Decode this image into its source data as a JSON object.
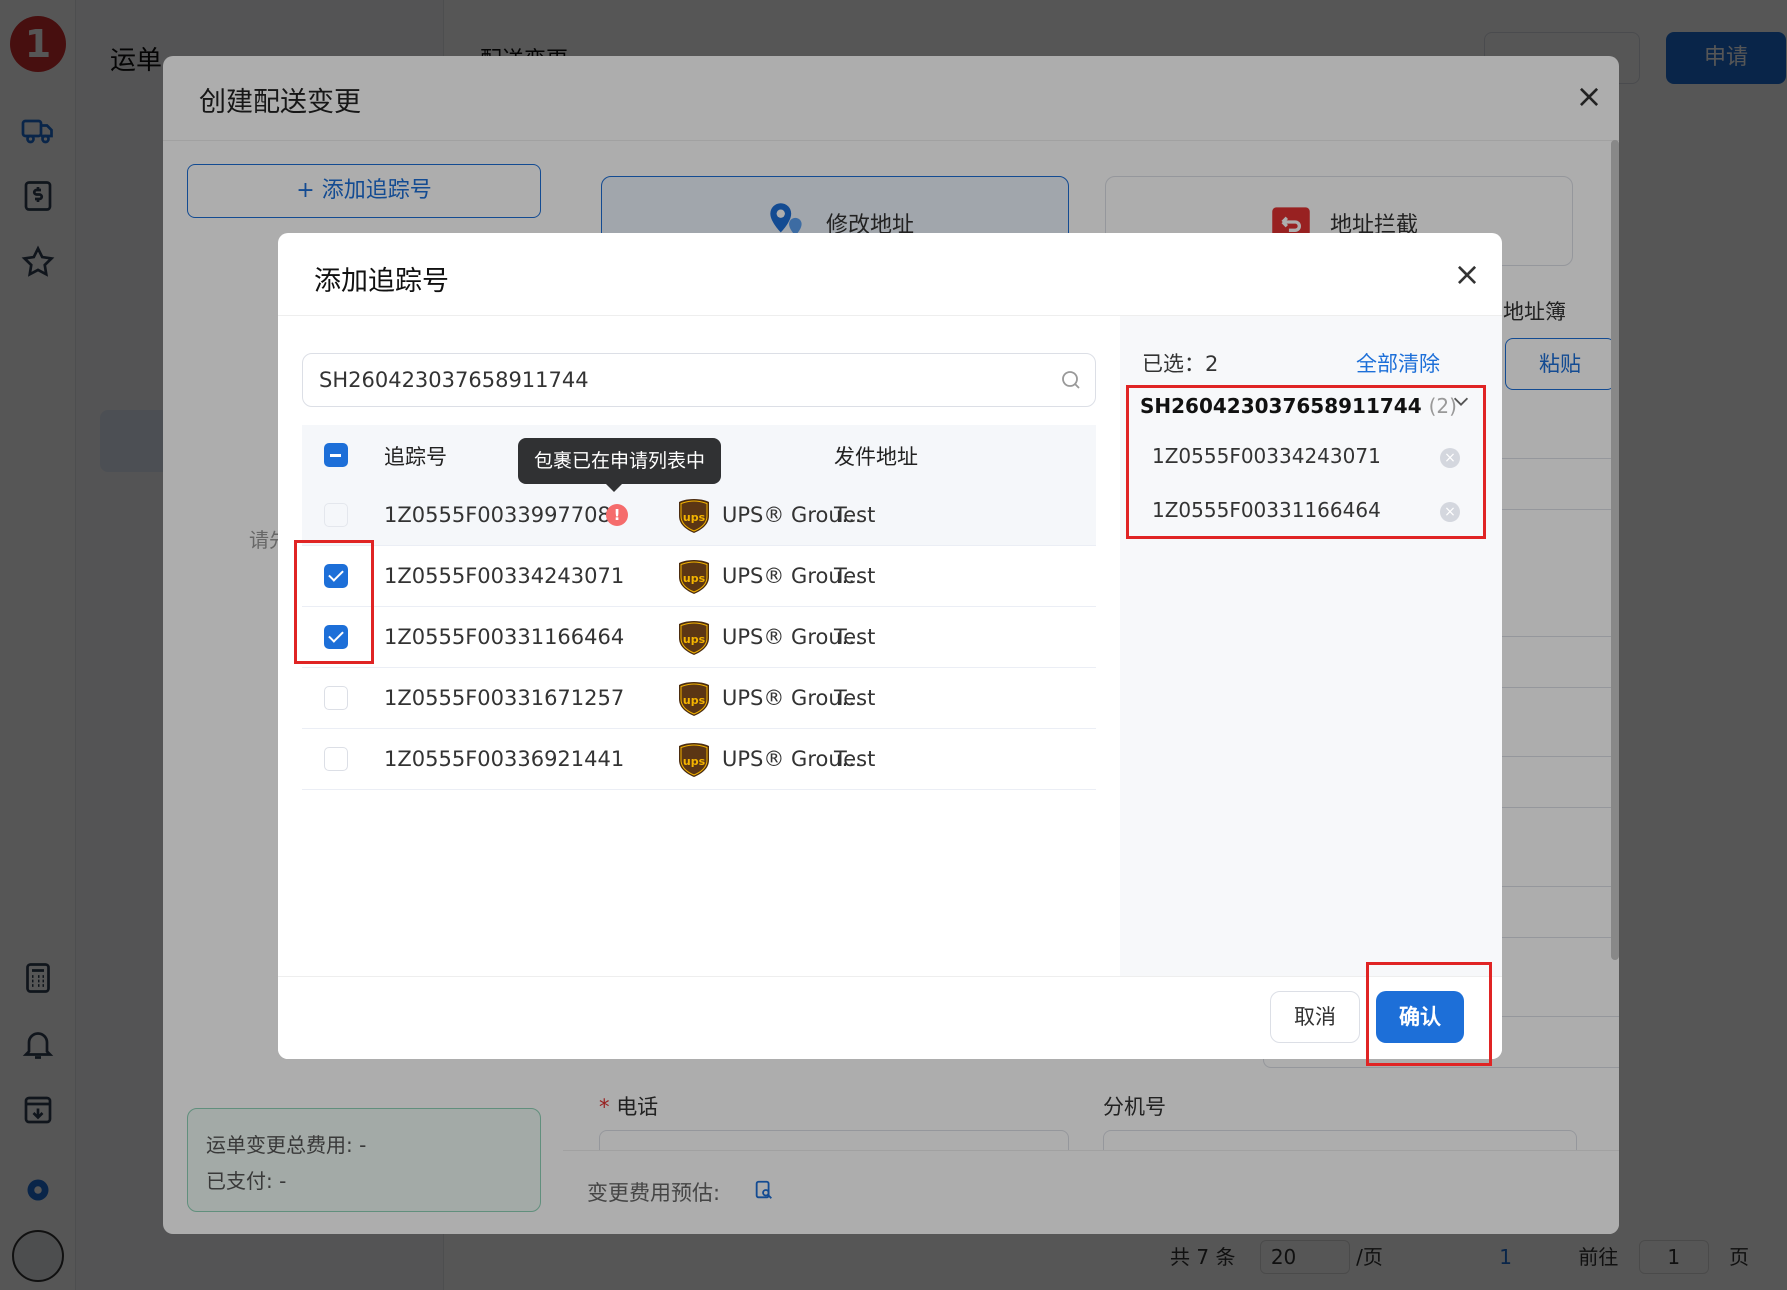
{
  "app": {
    "logo_text": "1",
    "nav_title": "运单",
    "base_header": "配送变更",
    "apply_button": "申请",
    "left_hint": "请先",
    "pager": {
      "total": "共 7 条",
      "page_size": "20",
      "per_page": "/页",
      "current": "1",
      "goto": "前往",
      "goto_value": "1",
      "page_unit": "页"
    }
  },
  "create_dialog": {
    "title": "创建配送变更",
    "add_tracking_button": "+ 添加追踪号",
    "options": [
      {
        "label": "修改地址",
        "icon": "location-pin-icon",
        "active": true
      },
      {
        "label": "地址拦截",
        "icon": "return-box-icon",
        "active": false
      }
    ],
    "address_book": "地址簿",
    "paste_button": "粘贴",
    "phone_label": "电话",
    "ext_label": "分机号",
    "fee_total_label": "运单变更总费用:",
    "fee_total_value": "-",
    "paid_label": "已支付:",
    "paid_value": "-",
    "estimate_label": "变更费用预估:"
  },
  "add_dialog": {
    "title": "添加追踪号",
    "search_value": "SH260423037658911744",
    "columns": {
      "tracking": "追踪号",
      "address": "发件地址"
    },
    "tooltip": "包裹已在申请列表中",
    "rows": [
      {
        "tracking": "1Z0555F00339977083",
        "service": "UPS® Grou...",
        "address": "Test",
        "checked": false,
        "disabled": true,
        "warning": true
      },
      {
        "tracking": "1Z0555F00334243071",
        "service": "UPS® Grou...",
        "address": "Test",
        "checked": true,
        "disabled": false,
        "warning": false
      },
      {
        "tracking": "1Z0555F00331166464",
        "service": "UPS® Grou...",
        "address": "Test",
        "checked": true,
        "disabled": false,
        "warning": false
      },
      {
        "tracking": "1Z0555F00331671257",
        "service": "UPS® Grou...",
        "address": "Test",
        "checked": false,
        "disabled": false,
        "warning": false
      },
      {
        "tracking": "1Z0555F00336921441",
        "service": "UPS® Grou...",
        "address": "Test",
        "checked": false,
        "disabled": false,
        "warning": false
      }
    ],
    "selected_label": "已选：2",
    "clear_all": "全部清除",
    "group_name": "SH260423037658911744",
    "group_count": "(2)",
    "selected_items": [
      "1Z0555F00334243071",
      "1Z0555F00331166464"
    ],
    "cancel_button": "取消",
    "confirm_button": "确认"
  },
  "colors": {
    "primary": "#1d6fd8",
    "highlight_box": "#e02424",
    "warning": "#f56c6c"
  }
}
